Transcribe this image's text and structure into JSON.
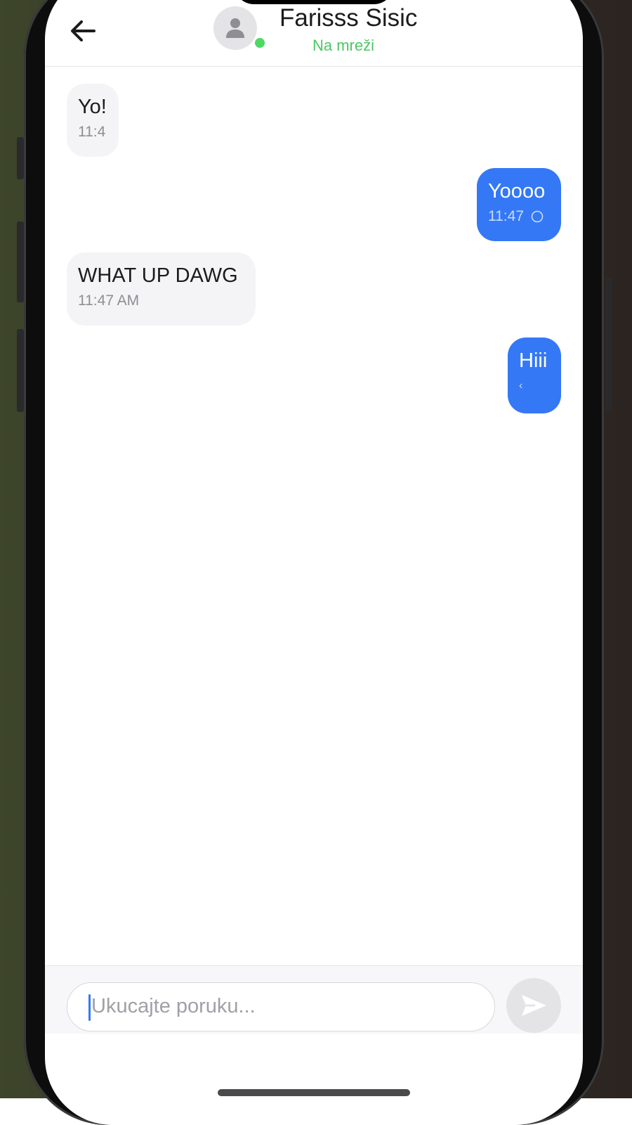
{
  "chat": {
    "contact_name": "Farisss Sisic",
    "status": "Na mreži"
  },
  "messages": [
    {
      "direction": "incoming",
      "text": "Yo!",
      "time": "11:4"
    },
    {
      "direction": "outgoing",
      "text": "Yoooo",
      "time": "11:47"
    },
    {
      "direction": "incoming",
      "text": "WHAT UP DAWG",
      "time": "11:47 AM"
    },
    {
      "direction": "outgoing",
      "text": "Hiii",
      "time": "‹"
    }
  ],
  "composer": {
    "placeholder": "Ukucajte poruku..."
  },
  "icons": {
    "back": "arrow-left-icon",
    "avatar": "person-icon",
    "message_status": "pending-circle-icon",
    "send": "send-arrow-icon"
  },
  "colors": {
    "online": "#4cc764",
    "outgoing_bubble": "#3478f6",
    "incoming_bubble": "#f4f4f6"
  }
}
